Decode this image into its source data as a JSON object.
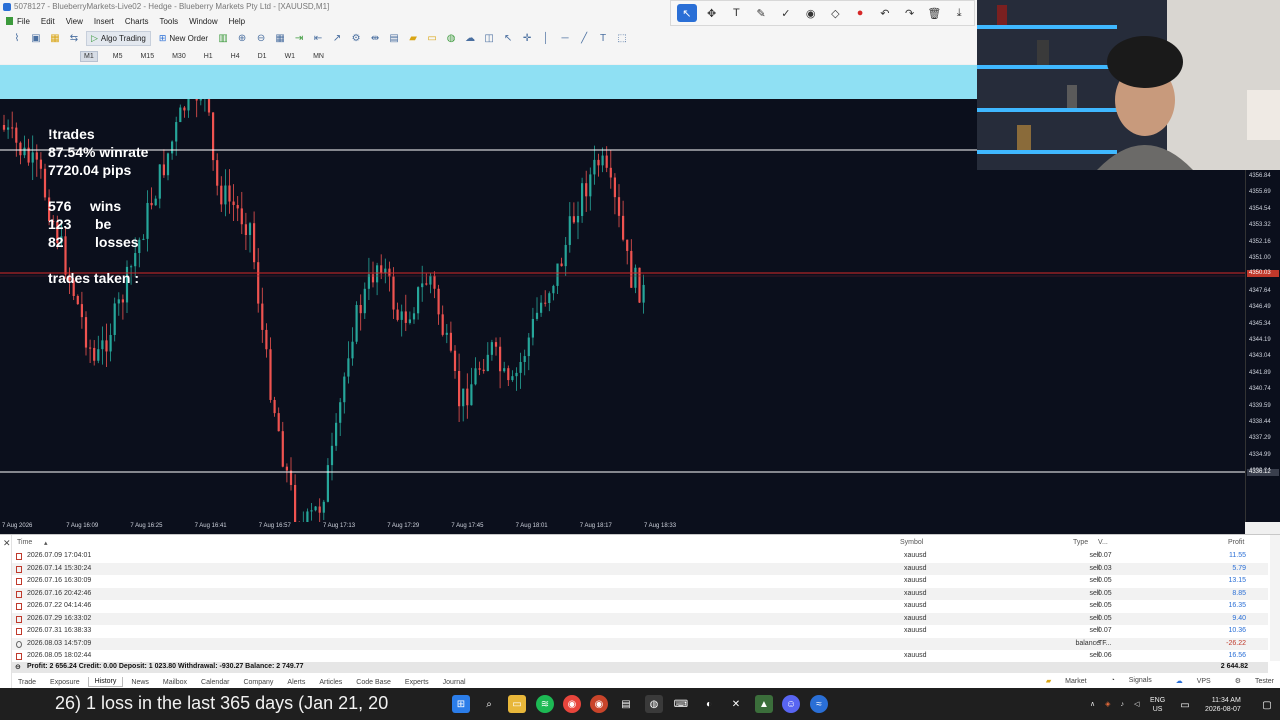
{
  "window": {
    "title": "5078127 - BlueberryMarkets-Live02 - Hedge - Blueberry Markets Pty Ltd - [XAUUSD,M1]"
  },
  "menu": {
    "items": [
      "File",
      "Edit",
      "View",
      "Insert",
      "Charts",
      "Tools",
      "Window",
      "Help"
    ]
  },
  "toolbar": {
    "algo_trading_label": "Algo Trading",
    "new_order_label": "New Order"
  },
  "timeframes": {
    "items": [
      "M1",
      "M5",
      "M15",
      "M30",
      "H1",
      "H4",
      "D1",
      "W1",
      "MN"
    ],
    "active": "M1"
  },
  "overlay": {
    "title": "!trades",
    "winrate": "87.54% winrate",
    "pips": "7720.04 pips",
    "wins_count": "576",
    "wins_label": "wins",
    "be_count": "123",
    "be_label": "be",
    "losses_count": "82",
    "losses_label": "losses",
    "trades_taken": "trades taken :"
  },
  "price_axis": {
    "labels": [
      "4356.84",
      "4355.69",
      "4354.54",
      "4353.32",
      "4352.16",
      "4351.00",
      "4348.79",
      "4347.64",
      "4346.49",
      "4345.34",
      "4344.19",
      "4343.04",
      "4341.89",
      "4340.74",
      "4339.59",
      "4338.44",
      "4337.29",
      "4334.99",
      "4333.84"
    ],
    "current_price": "4350.03",
    "level_price": "4336.12"
  },
  "time_axis": {
    "labels": [
      "7 Aug 2026",
      "7 Aug 16:09",
      "7 Aug 16:25",
      "7 Aug 16:41",
      "7 Aug 16:57",
      "7 Aug 17:13",
      "7 Aug 17:29",
      "7 Aug 17:45",
      "7 Aug 18:01",
      "7 Aug 18:17",
      "7 Aug 18:33"
    ]
  },
  "history": {
    "columns": {
      "time": "Time",
      "symbol": "Symbol",
      "type": "Type",
      "volume": "V...",
      "profit": "Profit"
    },
    "rows": [
      {
        "time": "2026.07.09 17:04:01",
        "symbol": "xauusd",
        "type": "sell",
        "volume": "0.07",
        "profit": "11.55",
        "kind": "trade"
      },
      {
        "time": "2026.07.14 15:30:24",
        "symbol": "xauusd",
        "type": "sell",
        "volume": "0.03",
        "profit": "5.79",
        "kind": "trade"
      },
      {
        "time": "2026.07.16 16:30:09",
        "symbol": "xauusd",
        "type": "sell",
        "volume": "0.05",
        "profit": "13.15",
        "kind": "trade"
      },
      {
        "time": "2026.07.16 20:42:46",
        "symbol": "xauusd",
        "type": "sell",
        "volume": "0.05",
        "profit": "8.85",
        "kind": "trade"
      },
      {
        "time": "2026.07.22 04:14:46",
        "symbol": "xauusd",
        "type": "sell",
        "volume": "0.05",
        "profit": "16.35",
        "kind": "trade"
      },
      {
        "time": "2026.07.29 16:33:02",
        "symbol": "xauusd",
        "type": "sell",
        "volume": "0.05",
        "profit": "9.40",
        "kind": "trade"
      },
      {
        "time": "2026.07.31 16:38:33",
        "symbol": "xauusd",
        "type": "sell",
        "volume": "0.07",
        "profit": "10.36",
        "kind": "trade"
      },
      {
        "time": "2026.08.03 14:57:09",
        "symbol": "",
        "type": "balance",
        "volume": "TF...",
        "profit": "-26.22",
        "kind": "balance"
      },
      {
        "time": "2026.08.05 18:02:44",
        "symbol": "xauusd",
        "type": "sell",
        "volume": "0.06",
        "profit": "16.56",
        "kind": "trade"
      }
    ],
    "summary": "Profit: 2 656.24  Credit: 0.00  Deposit: 1 023.80  Withdrawal: -930.27  Balance: 2 749.77",
    "summary_total": "2 644.82"
  },
  "tabs": {
    "items": [
      "Trade",
      "Exposure",
      "History",
      "News",
      "Mailbox",
      "Calendar",
      "Company",
      "Alerts",
      "Articles",
      "Code Base",
      "Experts",
      "Journal"
    ],
    "active": "History",
    "right": [
      "Market",
      "Signals",
      "VPS",
      "Tester"
    ]
  },
  "taskbar": {
    "ticker": "26) 1 loss in the last 365 days (Jan 21, 20",
    "lang_top": "ENG",
    "lang_bottom": "US",
    "time": "11:34 AM",
    "date": "2026-08-07"
  },
  "colors": {
    "chart_bg": "#0b0f1c",
    "bull": "#26a69a",
    "bear": "#ef5350",
    "header_band": "#8fe0f3",
    "accent": "#2a6fd6"
  }
}
